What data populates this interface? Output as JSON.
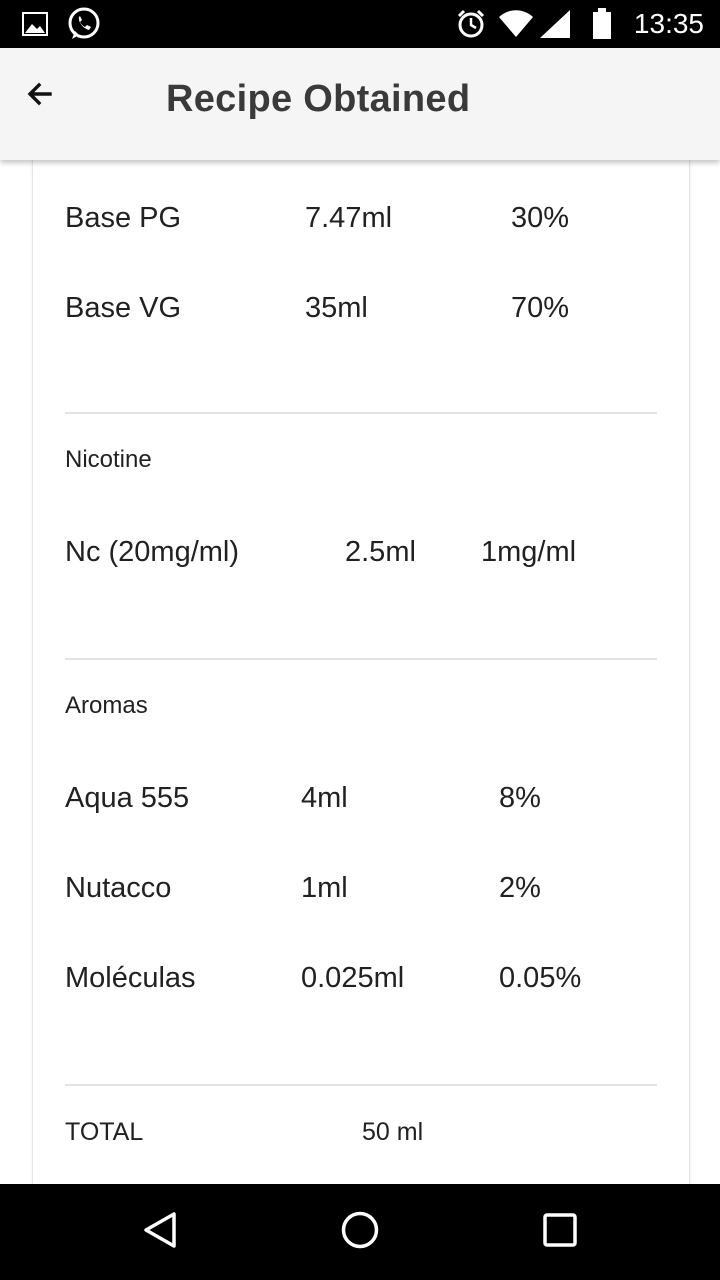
{
  "status_bar": {
    "time": "13:35",
    "icons": [
      "image-icon",
      "whatsapp-icon",
      "alarm-icon",
      "wifi-icon",
      "signal-icon",
      "battery-icon"
    ]
  },
  "app_bar": {
    "title": "Recipe Obtained",
    "back_icon": "arrow-back-icon"
  },
  "base": {
    "rows": [
      {
        "name": "Base PG",
        "amount": "7.47ml",
        "value": "30%"
      },
      {
        "name": "Base VG",
        "amount": "35ml",
        "value": "70%"
      }
    ]
  },
  "nicotine": {
    "title": "Nicotine",
    "rows": [
      {
        "name": "Nc (20mg/ml)",
        "amount": "2.5ml",
        "value": "1mg/ml"
      }
    ]
  },
  "aromas": {
    "title": "Aromas",
    "rows": [
      {
        "name": "Aqua 555",
        "amount": "4ml",
        "value": "8%"
      },
      {
        "name": "Nutacco",
        "amount": "1ml",
        "value": "2%"
      },
      {
        "name": "Moléculas",
        "amount": "0.025ml",
        "value": "0.05%"
      }
    ]
  },
  "total": {
    "label": "TOTAL",
    "value": "50 ml"
  },
  "nav_bar": {
    "icons": [
      "back-triangle-icon",
      "home-circle-icon",
      "recents-square-icon"
    ]
  }
}
